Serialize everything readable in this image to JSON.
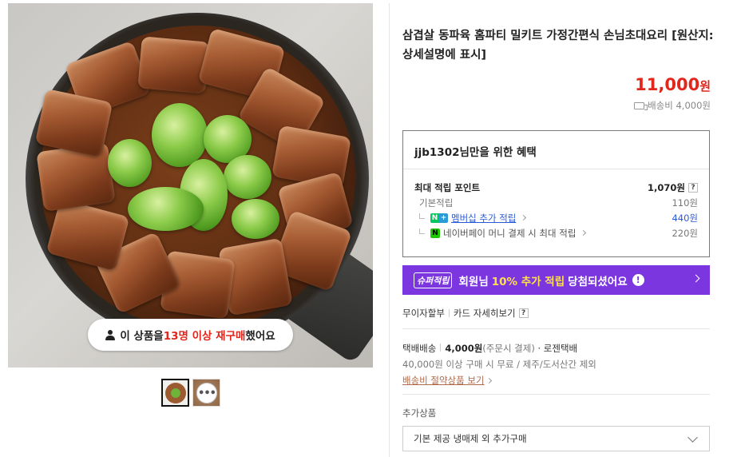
{
  "product": {
    "title": "삼겹살 동파육 홈파티 밀키트 가정간편식 손님초대요리 [원산지:상세설명에 표시]",
    "price_value": "11,000",
    "price_unit": "원",
    "shipping_fee": "배송비 4,000원"
  },
  "image": {
    "repurchase_prefix": "이 상품을 ",
    "repurchase_highlight": "13명 이상 재구매",
    "repurchase_suffix": " 했어요"
  },
  "benefit": {
    "header": "jjb1302님만을 위한 혜택",
    "max_points_label": "최대 적립 포인트",
    "max_points_value": "1,070원",
    "help": "?",
    "rows": [
      {
        "label": "기본적립",
        "value": "110원"
      },
      {
        "label": "멤버십 추가 적립",
        "value": "440원"
      },
      {
        "label": "네이버페이 머니 결제 시 최대 적립",
        "value": "220원"
      }
    ]
  },
  "super_banner": {
    "badge": "슈퍼적립",
    "text_prefix": "회원님 ",
    "highlight": "10% 추가 적립",
    "text_suffix": " 당첨되셨어요"
  },
  "installment": {
    "left": "무이자할부",
    "right": "카드 자세히보기",
    "help": "?"
  },
  "delivery": {
    "type": "택배배송",
    "fee": "4,000원",
    "fee_note": "(주문시 결제)",
    "carrier": "· 로젠택배",
    "condition": "40,000원 이상 구매 시 무료 / 제주/도서산간 제외",
    "link": "배송비 절약상품 보기"
  },
  "addon": {
    "label": "추가상품",
    "selected": "기본 제공 냉매제 외 추가구매"
  },
  "colors": {
    "price": "#e1261c",
    "super_banner": "#7b36e0",
    "link_blue": "#2a5bd7"
  }
}
